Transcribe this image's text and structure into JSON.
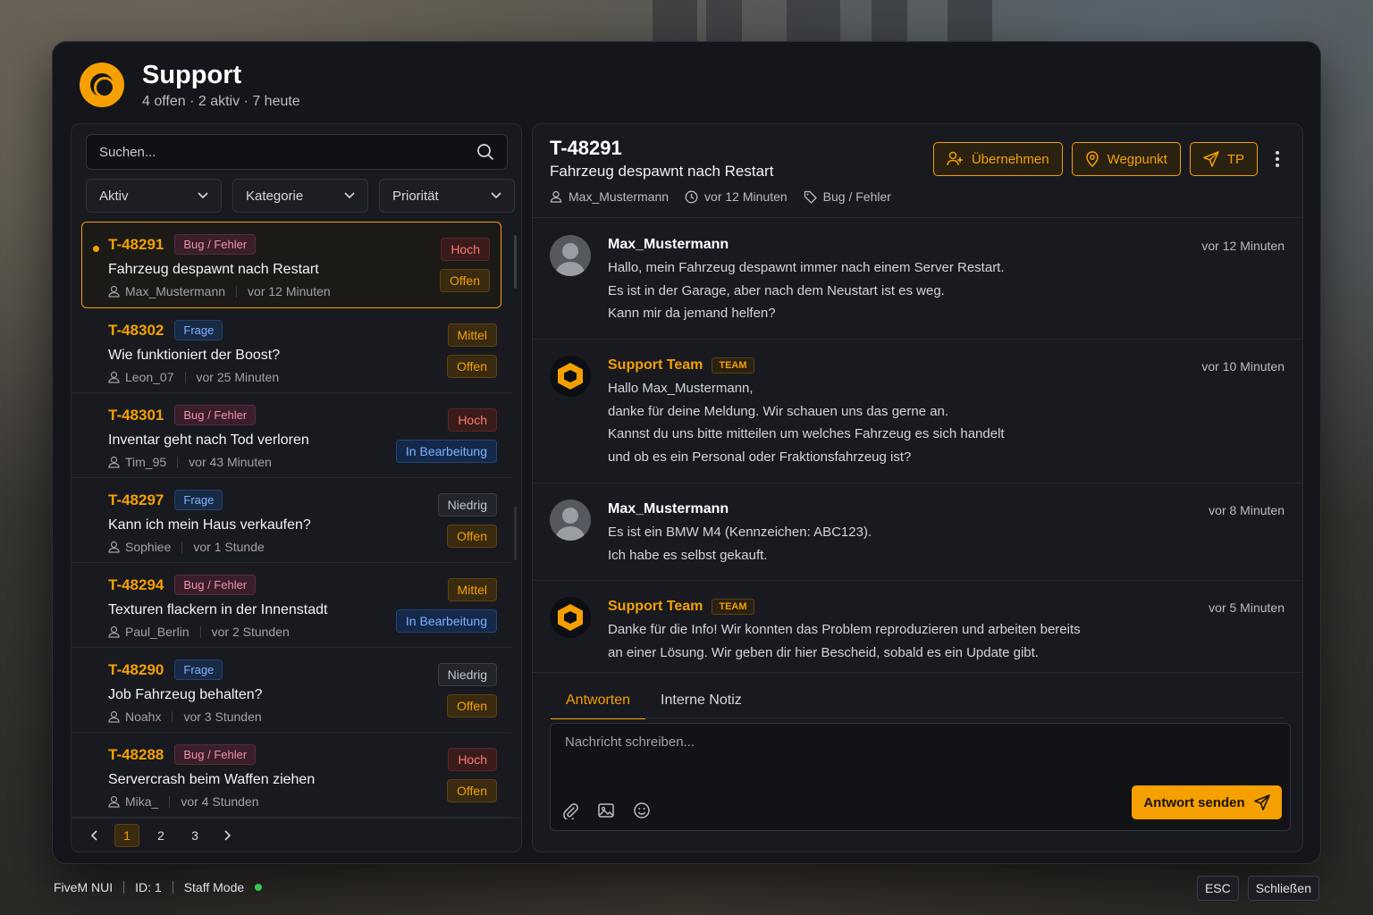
{
  "app": {
    "title": "Support",
    "subtitle": "4 offen · 2 aktiv · 7 heute",
    "accent": "#f5a000"
  },
  "search": {
    "placeholder": "Suchen..."
  },
  "filters": [
    "Aktiv",
    "Kategorie",
    "Priorität"
  ],
  "tickets": [
    {
      "id": "T-48291",
      "category": "Bug / Fehler",
      "cat_type": "bug",
      "title": "Fahrzeug despawnt nach Restart",
      "user": "Max_Mustermann",
      "time": "vor 12 Minuten",
      "priority": "Hoch",
      "prio_type": "hoch",
      "status": "Offen",
      "status_type": "offen",
      "selected": true
    },
    {
      "id": "T-48302",
      "category": "Frage",
      "cat_type": "frage",
      "title": "Wie funktioniert der Boost?",
      "user": "Leon_07",
      "time": "vor 25 Minuten",
      "priority": "Mittel",
      "prio_type": "mittel",
      "status": "Offen",
      "status_type": "offen"
    },
    {
      "id": "T-48301",
      "category": "Bug / Fehler",
      "cat_type": "bug",
      "title": "Inventar geht nach Tod verloren",
      "user": "Tim_95",
      "time": "vor 43 Minuten",
      "priority": "Hoch",
      "prio_type": "hoch",
      "status": "In Bearbeitung",
      "status_type": "bear"
    },
    {
      "id": "T-48297",
      "category": "Frage",
      "cat_type": "frage",
      "title": "Kann ich mein Haus verkaufen?",
      "user": "Sophiee",
      "time": "vor 1 Stunde",
      "priority": "Niedrig",
      "prio_type": "niedrig",
      "status": "Offen",
      "status_type": "offen"
    },
    {
      "id": "T-48294",
      "category": "Bug / Fehler",
      "cat_type": "bug",
      "title": "Texturen flackern in der Innenstadt",
      "user": "Paul_Berlin",
      "time": "vor 2 Stunden",
      "priority": "Mittel",
      "prio_type": "mittel",
      "status": "In Bearbeitung",
      "status_type": "bear"
    },
    {
      "id": "T-48290",
      "category": "Frage",
      "cat_type": "frage",
      "title": "Job Fahrzeug behalten?",
      "user": "Noahx",
      "time": "vor 3 Stunden",
      "priority": "Niedrig",
      "prio_type": "niedrig",
      "status": "Offen",
      "status_type": "offen"
    },
    {
      "id": "T-48288",
      "category": "Bug / Fehler",
      "cat_type": "bug",
      "title": "Servercrash beim Waffen ziehen",
      "user": "Mika_",
      "time": "vor 4 Stunden",
      "priority": "Hoch",
      "prio_type": "hoch",
      "status": "Offen",
      "status_type": "offen"
    }
  ],
  "pagination": {
    "pages": [
      "1",
      "2",
      "3"
    ],
    "current": "1"
  },
  "detail": {
    "id": "T-48291",
    "title": "Fahrzeug despawnt nach Restart",
    "user": "Max_Mustermann",
    "time": "vor 12 Minuten",
    "category": "Bug / Fehler",
    "actions": {
      "take": "Übernehmen",
      "waypoint": "Wegpunkt",
      "tp": "TP"
    }
  },
  "messages": [
    {
      "author": "Max_Mustermann",
      "team": false,
      "time": "vor 12 Minuten",
      "lines": [
        "Hallo, mein Fahrzeug despawnt immer nach einem Server Restart.",
        "Es ist in der Garage, aber nach dem Neustart ist es weg.",
        "Kann mir da jemand helfen?"
      ]
    },
    {
      "author": "Support Team",
      "team": true,
      "tag": "TEAM",
      "time": "vor 10 Minuten",
      "lines": [
        "Hallo Max_Mustermann,",
        "danke für deine Meldung. Wir schauen uns das gerne an.",
        "Kannst du uns bitte mitteilen um welches Fahrzeug es sich handelt",
        "und ob es ein Personal oder Fraktionsfahrzeug ist?"
      ]
    },
    {
      "author": "Max_Mustermann",
      "team": false,
      "time": "vor 8 Minuten",
      "lines": [
        "Es ist ein BMW M4 (Kennzeichen: ABC123).",
        "Ich habe es selbst gekauft."
      ]
    },
    {
      "author": "Support Team",
      "team": true,
      "tag": "TEAM",
      "time": "vor 5 Minuten",
      "lines": [
        "Danke für die Info! Wir konnten das Problem reproduzieren und arbeiten bereits",
        "an einer Lösung. Wir geben dir hier Bescheid, sobald es ein Update gibt."
      ]
    }
  ],
  "composer": {
    "tabs": [
      "Antworten",
      "Interne Notiz"
    ],
    "active_tab": "Antworten",
    "placeholder": "Nachricht schreiben...",
    "send_label": "Antwort senden"
  },
  "footer": {
    "app": "FiveM NUI",
    "id": "ID: 1",
    "mode": "Staff Mode",
    "esc_key": "ESC",
    "close_label": "Schließen"
  }
}
